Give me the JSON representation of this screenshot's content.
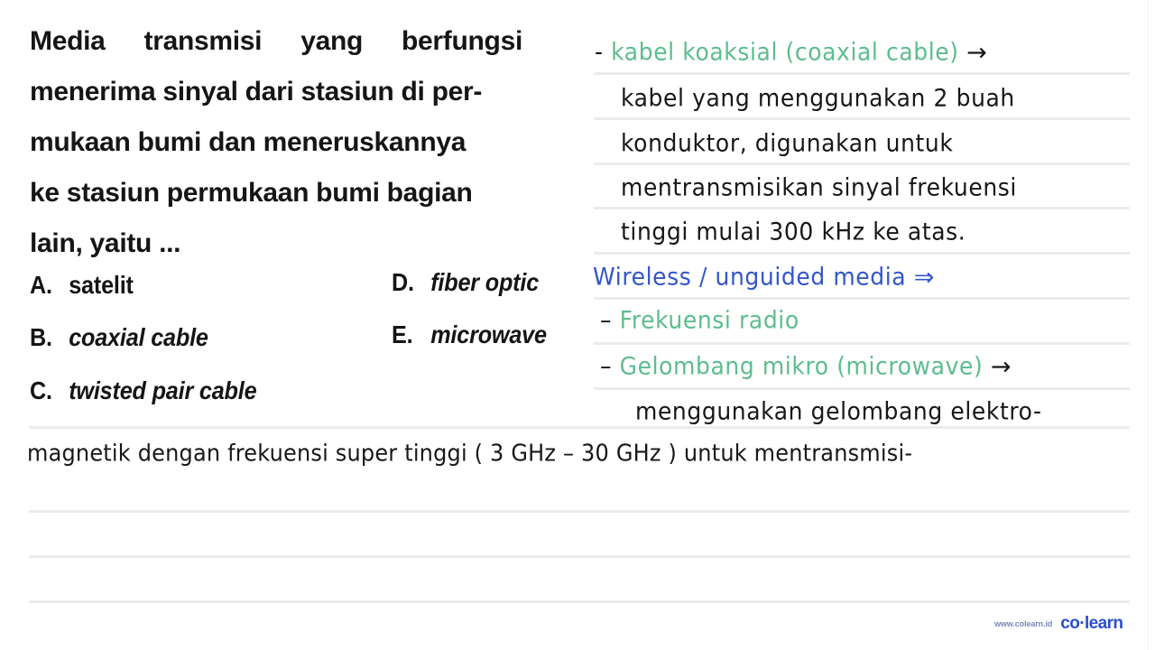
{
  "document": {
    "type": "worksheet-with-handwritten-notes",
    "background_color": "#ffffff",
    "rule_line_color": "#ececec"
  },
  "question": {
    "lines": [
      "Media  transmisi  yang  berfungsi",
      "menerima sinyal dari stasiun di per-",
      "mukaan bumi dan meneruskannya",
      "ke stasiun permukaan bumi bagian",
      "lain, yaitu ..."
    ],
    "justified_words": [
      "Media",
      "transmisi",
      "yang",
      "berfungsi"
    ]
  },
  "options": {
    "column_left": [
      {
        "letter": "A.",
        "text": "satelit",
        "style": "plain"
      },
      {
        "letter": "B.",
        "text": "coaxial cable",
        "style": "italic"
      },
      {
        "letter": "C.",
        "text": "twisted pair cable",
        "style": "italic"
      }
    ],
    "column_right": [
      {
        "letter": "D.",
        "text": "fiber optic",
        "style": "italic"
      },
      {
        "letter": "E.",
        "text": "microwave",
        "style": "italic"
      }
    ]
  },
  "notes": {
    "colors": {
      "green": "#5cbd8e",
      "blue": "#3456c8",
      "black": "#17171a"
    },
    "lines": [
      {
        "id": "note-coaxial-heading",
        "bullet": "-",
        "text": "kabel koaksial (coaxial cable)",
        "color": "green",
        "trailing_symbol": "→"
      },
      {
        "id": "note-coaxial-body-1",
        "text": "kabel yang menggunakan 2 buah",
        "color": "black"
      },
      {
        "id": "note-coaxial-body-2",
        "text": "konduktor, digunakan untuk",
        "color": "black"
      },
      {
        "id": "note-coaxial-body-3",
        "text": "mentransmisikan sinyal frekuensi",
        "color": "black"
      },
      {
        "id": "note-coaxial-body-4",
        "text": "tinggi mulai 300 kHz ke atas.",
        "color": "black"
      },
      {
        "id": "note-wireless-heading",
        "text": "Wireless / unguided media",
        "color": "blue",
        "trailing_symbol": "⇒"
      },
      {
        "id": "note-radio",
        "bullet": "–",
        "text": "Frekuensi radio",
        "color": "green"
      },
      {
        "id": "note-microwave-heading",
        "bullet": "–",
        "text": "Gelombang mikro (microwave)",
        "color": "green",
        "trailing_symbol": "→"
      },
      {
        "id": "note-microwave-body-1",
        "text": "menggunakan gelombang elektro-",
        "color": "black"
      },
      {
        "id": "note-microwave-body-2",
        "text": "magnetik dengan frekuensi super tinggi ( 3 GHz  –  30  GHz ) untuk mentransmisi-",
        "color": "black"
      }
    ]
  },
  "footer": {
    "url": "www.colearn.id",
    "brand": "co·learn"
  }
}
